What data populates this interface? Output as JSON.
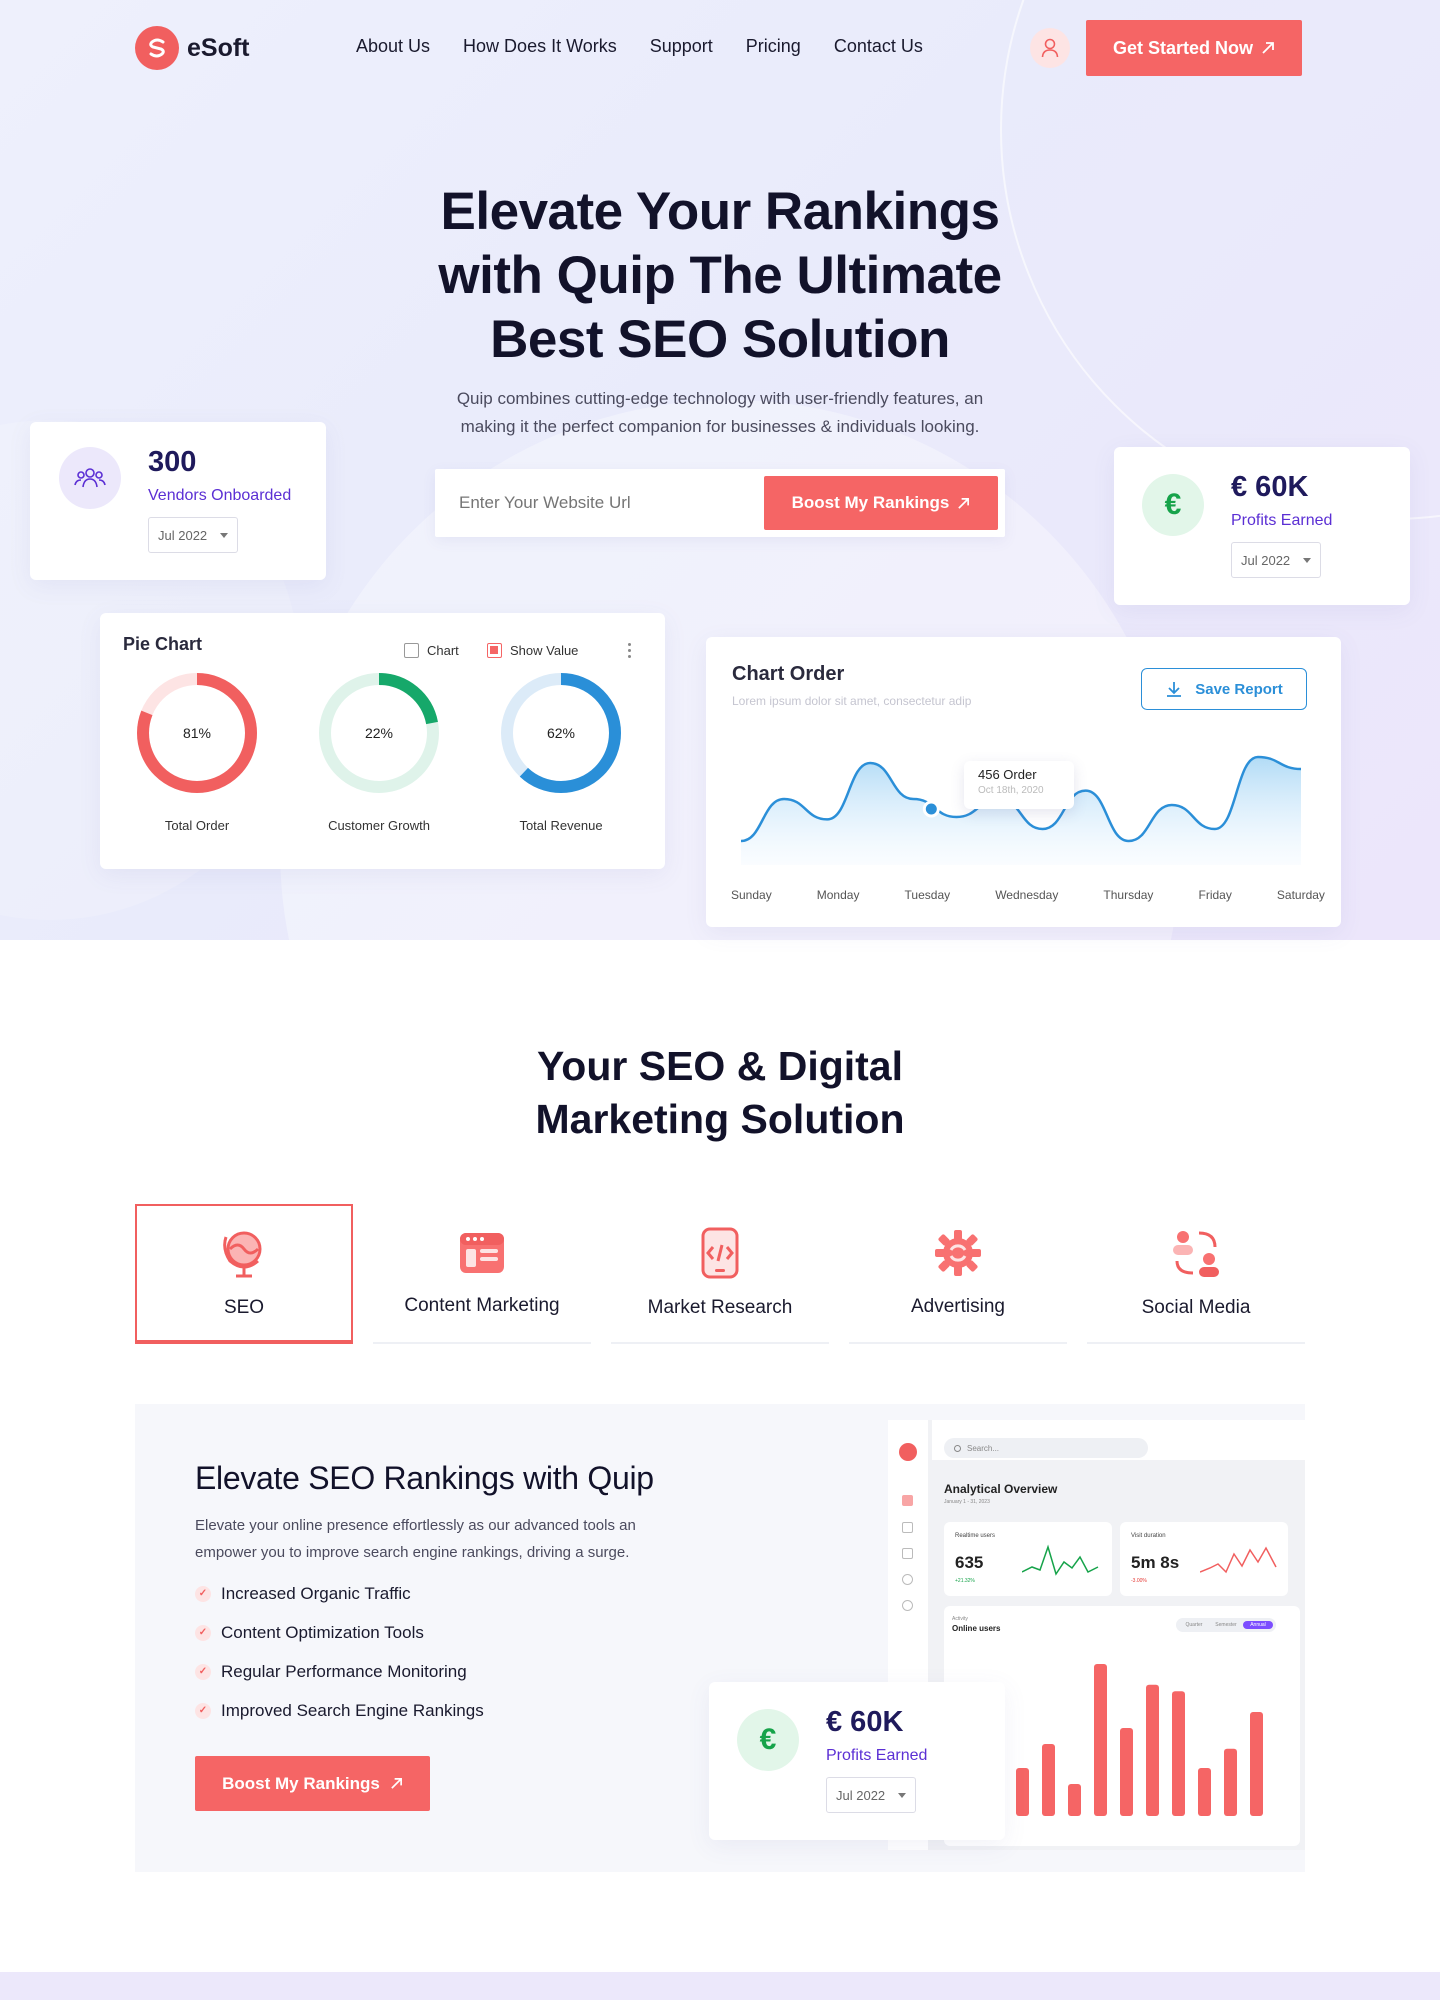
{
  "brand": {
    "name": "eSoft",
    "accent": "#f56565",
    "purple": "#5b2fd4"
  },
  "nav": {
    "items": [
      "About Us",
      "How Does It Works",
      "Support",
      "Pricing",
      "Contact Us"
    ],
    "cta": "Get Started Now"
  },
  "hero": {
    "title_l1": "Elevate Your Rankings",
    "title_l2": "with Quip The Ultimate",
    "title_l3": "Best SEO Solution",
    "sub_l1": "Quip combines cutting-edge technology with user-friendly features, an",
    "sub_l2": "making it the perfect companion for businesses & individuals looking.",
    "search_placeholder": "Enter Your Website Url",
    "search_button": "Boost My Rankings"
  },
  "vendors_card": {
    "value": "300",
    "label": "Vendors Onboarded",
    "period": "Jul 2022",
    "icon": "users-icon"
  },
  "profit_card": {
    "value": "€ 60K",
    "label": "Profits Earned",
    "period": "Jul 2022",
    "icon": "euro-icon"
  },
  "pie_card": {
    "title": "Pie Chart",
    "opt_chart": "Chart",
    "opt_show_value": "Show Value",
    "donuts": [
      {
        "label": "Total Order",
        "value_text": "81%",
        "value": 81,
        "color": "#f15f5f",
        "track": "#fde4e4"
      },
      {
        "label": "Customer Growth",
        "value_text": "22%",
        "value": 22,
        "color": "#16a86a",
        "track": "#dff3ea"
      },
      {
        "label": "Total Revenue",
        "value_text": "62%",
        "value": 62,
        "color": "#2a8fd8",
        "track": "#dcebf8"
      }
    ]
  },
  "order_card": {
    "title": "Chart Order",
    "subtitle": "Lorem ipsum dolor sit amet, consectetur adip",
    "save_label": "Save Report",
    "tooltip_value": "456 Order",
    "tooltip_date": "Oct 18th, 2020"
  },
  "chart_data": {
    "type": "area",
    "x": [
      "Sunday",
      "Monday",
      "Tuesday",
      "Wednesday",
      "Thursday",
      "Friday",
      "Saturday"
    ],
    "series": [
      {
        "values": [
          20,
          55,
          38,
          85,
          55,
          40,
          55,
          30,
          62,
          20,
          50,
          30,
          90,
          80
        ]
      }
    ],
    "title": "Chart Order"
  },
  "services": {
    "title_l1": "Your SEO & Digital",
    "title_l2": "Marketing Solution",
    "tabs": [
      {
        "label": "SEO",
        "icon": "globe-icon"
      },
      {
        "label": "Content Marketing",
        "icon": "layout-icon"
      },
      {
        "label": "Market Research",
        "icon": "code-phone-icon"
      },
      {
        "label": "Advertising",
        "icon": "gear-icon"
      },
      {
        "label": "Social Media",
        "icon": "people-swap-icon"
      }
    ]
  },
  "feature": {
    "title": "Elevate SEO Rankings with Quip",
    "desc_l1": "Elevate your online presence effortlessly as our advanced tools an",
    "desc_l2": "empower you to improve search engine rankings, driving a surge.",
    "checks": [
      "Increased Organic Traffic",
      "Content Optimization Tools",
      "Regular Performance Monitoring",
      "Improved Search Engine Rankings"
    ],
    "button": "Boost My Rankings"
  },
  "dashboard": {
    "search": "Search...",
    "heading": "Analytical Overview",
    "date": "January 1 - 31, 2023",
    "m1_label": "Realtime users",
    "m1_value": "635",
    "m1_change": "+21.32%",
    "m2_label": "Visit duration",
    "m2_value": "5m 8s",
    "m2_change": "-3.00%",
    "activity": "Activity",
    "online": "Online users",
    "toggle": [
      "Quarter",
      "Semester",
      "Annual"
    ],
    "bars": [
      62,
      30,
      45,
      20,
      95,
      55,
      82,
      78,
      30,
      42,
      65
    ]
  }
}
